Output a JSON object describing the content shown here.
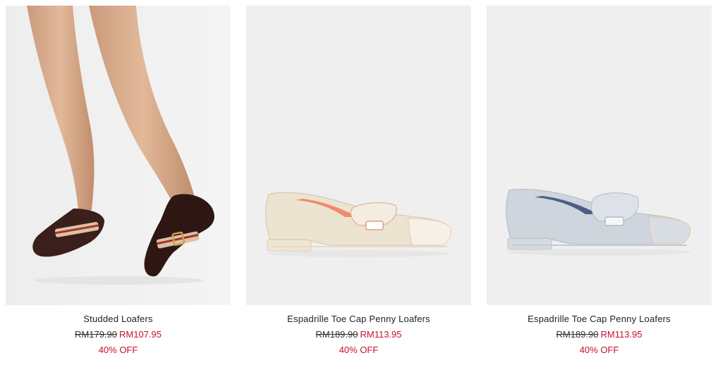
{
  "products": [
    {
      "name": "Studded Loafers",
      "original_price": "RM179.90",
      "sale_price": "RM107.95",
      "discount": "40% OFF",
      "image_icon": "studded-loafers-photo",
      "colors": {
        "shoe": "#3a1f1a",
        "strap": "#d9c2a4",
        "stripe": "#a8322a"
      }
    },
    {
      "name": "Espadrille Toe Cap Penny Loafers",
      "original_price": "RM189.90",
      "sale_price": "RM113.95",
      "discount": "40% OFF",
      "image_icon": "cream-penny-loafer-photo",
      "colors": {
        "shoe": "#ece3d1",
        "lining": "#f08a6c"
      }
    },
    {
      "name": "Espadrille Toe Cap Penny Loafers",
      "original_price": "RM189.90",
      "sale_price": "RM113.95",
      "discount": "40% OFF",
      "image_icon": "grey-penny-loafer-photo",
      "colors": {
        "shoe": "#cfd5dc",
        "lining": "#4a5d86"
      }
    }
  ],
  "theme": {
    "sale_color": "#c8102e",
    "text_color": "#222222",
    "photo_background": "#efefef"
  }
}
